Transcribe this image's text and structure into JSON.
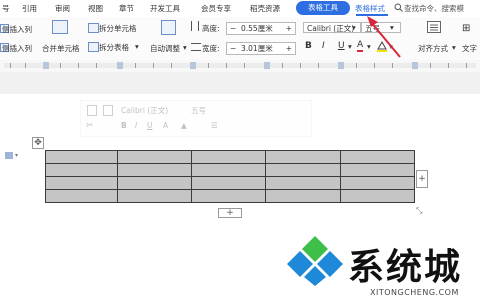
{
  "menu": {
    "items": [
      "号",
      "引用",
      "审阅",
      "视图",
      "章节",
      "开发工具",
      "会员专享",
      "稻壳资源"
    ],
    "active_tab": "表格工具",
    "style_tab": "表格样式",
    "search": "查找命令、搜索模"
  },
  "ribbon": {
    "insert_col_label": "侧插入列",
    "insert_col_label2": "侧插入列",
    "merge_cells": "合并单元格",
    "split_cells": "拆分单元格",
    "split_table": "拆分表格",
    "autofit": "自动调整",
    "height_label": "高度:",
    "height_value": "0.55厘米",
    "width_label": "宽度:",
    "width_value": "3.01厘米",
    "font_name": "Calibri (正文)",
    "font_size": "五号",
    "align": "对齐方式",
    "text_dir": "文字"
  },
  "mini_toolbar": {
    "font_name": "Calibri (正文)",
    "font_size": "五号"
  },
  "table": {
    "rows": 4,
    "cols": 5
  },
  "watermark": {
    "text": "系统城",
    "url": "XITONGCHENG.COM"
  },
  "colors": {
    "accent": "#2d6ee0",
    "cell_fill": "#c5c5c5",
    "arrow": "#d9263f",
    "logo_blue": "#1e88d9",
    "logo_green": "#3dbf4a"
  }
}
